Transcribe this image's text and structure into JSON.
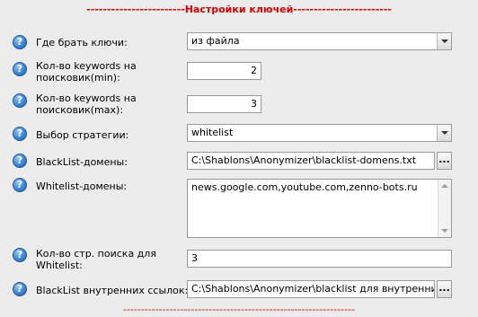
{
  "header": "------------------------Настройки ключей------------------------",
  "footer": "-----------------------------------------------------------------",
  "rows": [
    {
      "label": "Где брать ключи:",
      "value": "из файла"
    },
    {
      "label": "Кол-во keywords на поисковик(min):",
      "value": "2"
    },
    {
      "label": "Кол-во keywords на поисковик(max):",
      "value": "3"
    },
    {
      "label": "Выбор стратегии:",
      "value": "whitelist"
    },
    {
      "label": "BlackList-домены:",
      "value": "C:\\Shablons\\Anonymizer\\blacklist-domens.txt"
    },
    {
      "label": "Whitelist-домены:",
      "value": "news.google.com,youtube.com,zenno-bots.ru"
    },
    {
      "label": "Кол-во стр. поиска для Whitelist:",
      "value": "3"
    },
    {
      "label": "BlackList внутренних ссылок:",
      "value": "C:\\Shablons\\Anonymizer\\blacklist для внутренних ссыл"
    }
  ],
  "help_glyph": "?",
  "browse_glyph": "..."
}
